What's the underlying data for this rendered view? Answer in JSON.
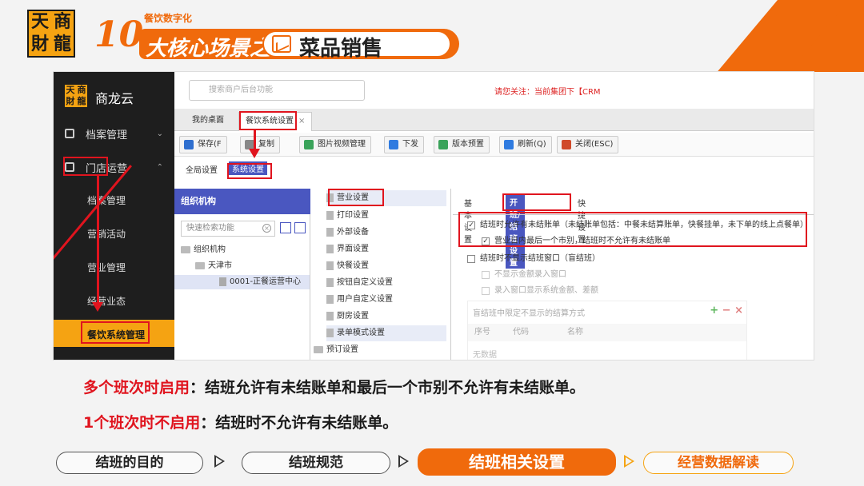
{
  "header": {
    "logo_chars": [
      "天",
      "商",
      "財",
      "龍"
    ],
    "number": "10",
    "subtitle": "餐饮数字化",
    "title": "大核心场景之",
    "badge_title": "菜品销售"
  },
  "sidebar": {
    "brand": "商龙云",
    "logo_chars": [
      "天",
      "商",
      "財",
      "龍"
    ],
    "items": [
      {
        "label": "档案管理"
      },
      {
        "label": "门店运营"
      }
    ],
    "sub_items": [
      "档案管理",
      "营销活动",
      "营业管理",
      "经营业态",
      "餐饮系统管理"
    ]
  },
  "topbar": {
    "search_placeholder": "搜索商户后台功能",
    "notice": "请您关注：当前集团下【CRM"
  },
  "tabs": [
    {
      "label": "我的桌面"
    },
    {
      "label": "餐饮系统设置"
    }
  ],
  "toolbar": [
    {
      "label": "保存(F",
      "color": "#2f6fcf"
    },
    {
      "label": "复制",
      "color": "#888"
    },
    {
      "label": "图片视频管理",
      "color": "#3aa35a"
    },
    {
      "label": "下发",
      "color": "#2f7be0"
    },
    {
      "label": "版本预置",
      "color": "#3aa35a"
    },
    {
      "label": "刷新(Q)",
      "color": "#2f7be0"
    },
    {
      "label": "关闭(ESC)",
      "color": "#d04a2a"
    }
  ],
  "subtabs": [
    "全局设置",
    "系统设置"
  ],
  "org": {
    "header": "组织机构",
    "search_placeholder": "快速检索功能",
    "tree": [
      "组织机构",
      "天津市",
      "0001-正餐运营中心"
    ]
  },
  "menu": [
    "营业设置",
    "打印设置",
    "外部设备",
    "界面设置",
    "快餐设置",
    "按钮自定义设置",
    "用户自定义设置",
    "厨房设置",
    "录单模式设置",
    "预订设置"
  ],
  "settings": {
    "tabs": [
      "基本设置",
      "开班/结班设置",
      "快捷设置"
    ],
    "options": [
      {
        "label": "结班时允许有未结账单（未结账单包括：中餐未结算账单，快餐挂单，未下单的线上点餐单）",
        "checked": "✓"
      },
      {
        "label": "营业日内最后一个市别，结班时不允许有未结账单",
        "checked": "✓"
      },
      {
        "label": "结班时不显示结班窗口（盲结班）",
        "checked": ""
      },
      {
        "label": "不显示金额录入窗口",
        "checked": ""
      },
      {
        "label": "录入窗口显示系统金额、差额",
        "checked": ""
      }
    ],
    "grid_title": "盲结班中限定不显示的结算方式",
    "grid_cols": [
      "序号",
      "代码",
      "名称"
    ],
    "grid_empty": "无数据"
  },
  "captions": {
    "line1_label": "多个班次时启用",
    "line1_text": "：结班允许有未结账单和最后一个市别不允许有未结账单。",
    "line2_label": "1个班次时不启用",
    "line2_text": "：结班时不允许有未结账单。"
  },
  "steps": [
    "结班的目的",
    "结班规范",
    "结班相关设置",
    "经营数据解读"
  ],
  "colors": {
    "accent": "#f06a0c",
    "gold": "#f5a312",
    "highlight_red": "#e0141e",
    "nav_blue": "#4a57c0"
  }
}
